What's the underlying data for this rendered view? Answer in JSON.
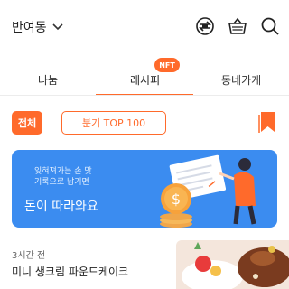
{
  "header": {
    "location": "반여동",
    "icons": [
      "location-dropdown-chevron-icon",
      "exchange-icon",
      "basket-icon",
      "search-icon"
    ]
  },
  "tabs": [
    {
      "label": "나눔",
      "active": false
    },
    {
      "label": "레시피",
      "active": true,
      "badge": "NFT"
    },
    {
      "label": "동네가게",
      "active": false
    }
  ],
  "filters": {
    "all_label": "전체",
    "top_label": "분기 TOP 100",
    "bookmark_icon": "bookmark-icon"
  },
  "banner": {
    "line1": "잊혀져가는 손 맛",
    "line2": "기록으로 남기면",
    "headline": "돈이 따라와요",
    "color": "#3b8cf0"
  },
  "post": {
    "time": "3시간 전",
    "title": "미니 생크림 파운드케이크"
  },
  "accent_color": "#ff6a2b"
}
